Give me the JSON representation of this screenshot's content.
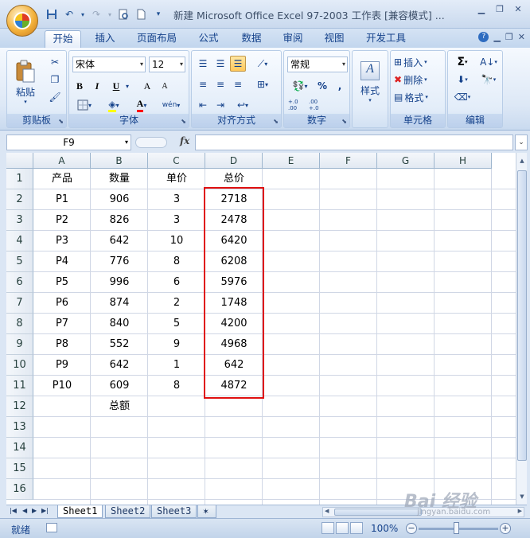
{
  "window": {
    "title": "新建 Microsoft Office Excel 97-2003 工作表 [兼容模式] ..."
  },
  "tabs": [
    "开始",
    "插入",
    "页面布局",
    "公式",
    "数据",
    "审阅",
    "视图",
    "开发工具"
  ],
  "ribbon": {
    "clipboard": {
      "label": "剪贴板",
      "paste": "粘贴"
    },
    "font": {
      "label": "字体",
      "name": "宋体",
      "size": "12",
      "bold": "B",
      "italic": "I",
      "underline": "U",
      "grow": "A",
      "shrink": "A",
      "color": "A",
      "wen": "wén"
    },
    "alignment": {
      "label": "对齐方式"
    },
    "number": {
      "label": "数字",
      "format": "常规",
      "percent": "%",
      "comma": ",",
      "inc": "+.0 .00",
      "dec": ".00 +.0"
    },
    "styles": {
      "label": "样式"
    },
    "cells": {
      "label": "单元格",
      "insert": "插入",
      "delete": "删除",
      "format": "格式"
    },
    "editing": {
      "label": "编辑",
      "sum": "Σ"
    }
  },
  "formula_bar": {
    "name_box": "F9",
    "fx": "fx",
    "value": ""
  },
  "columns": [
    "A",
    "B",
    "C",
    "D",
    "E",
    "F",
    "G",
    "H"
  ],
  "rows": [
    "1",
    "2",
    "3",
    "4",
    "5",
    "6",
    "7",
    "8",
    "9",
    "10",
    "11",
    "12",
    "13",
    "14",
    "15",
    "16"
  ],
  "table": {
    "headers": [
      "产品",
      "数量",
      "单价",
      "总价"
    ],
    "rows": [
      [
        "P1",
        "906",
        "3",
        "2718"
      ],
      [
        "P2",
        "826",
        "3",
        "2478"
      ],
      [
        "P3",
        "642",
        "10",
        "6420"
      ],
      [
        "P4",
        "776",
        "8",
        "6208"
      ],
      [
        "P5",
        "996",
        "6",
        "5976"
      ],
      [
        "P6",
        "874",
        "2",
        "1748"
      ],
      [
        "P7",
        "840",
        "5",
        "4200"
      ],
      [
        "P8",
        "552",
        "9",
        "4968"
      ],
      [
        "P9",
        "642",
        "1",
        "642"
      ],
      [
        "P10",
        "609",
        "8",
        "4872"
      ]
    ],
    "total_label": "总额"
  },
  "sheets": [
    "Sheet1",
    "Sheet2",
    "Sheet3"
  ],
  "status": {
    "ready": "就绪",
    "zoom": "100%"
  },
  "watermark": {
    "text": "Bai 经验",
    "url": "jingyan.baidu.com"
  },
  "colors": {
    "highlight": "#e01010",
    "ribbon": "#dbe6f4",
    "text": "#15428b"
  }
}
